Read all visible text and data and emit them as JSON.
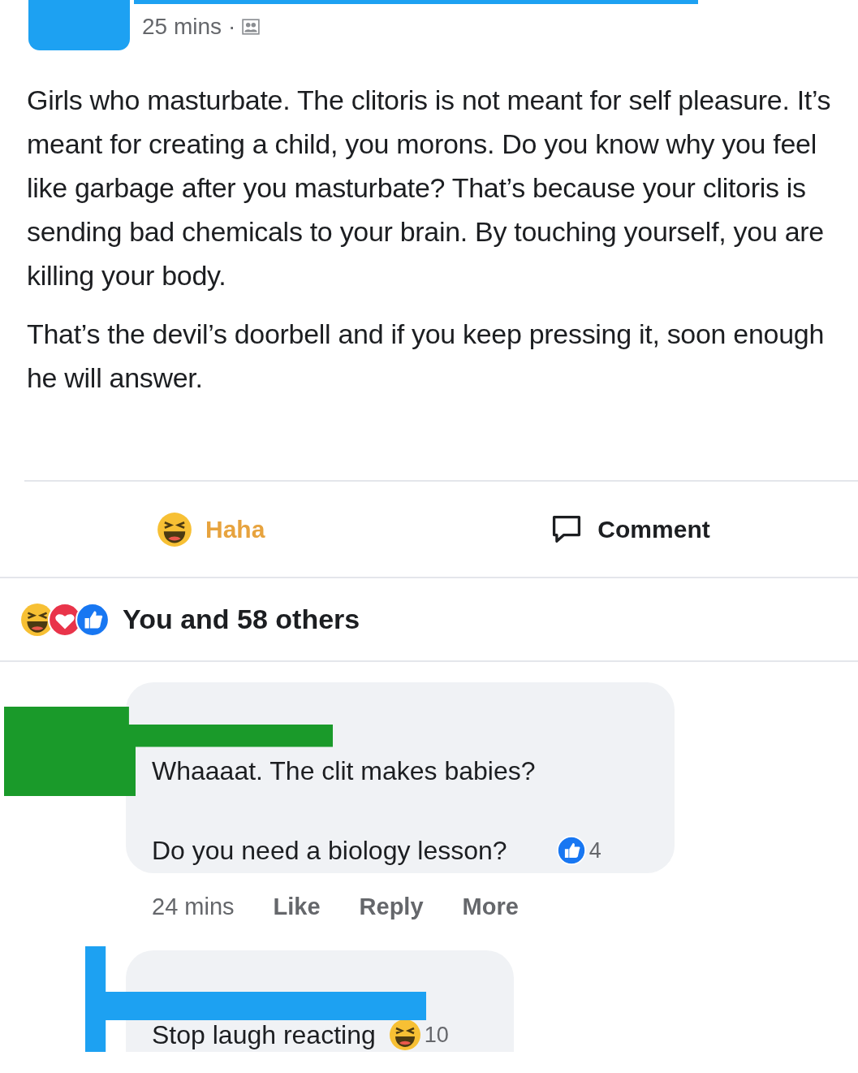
{
  "post": {
    "time": "25 mins",
    "separator": "·",
    "paragraphs": [
      "Girls who masturbate. The clitoris is not meant for self pleasure. It’s meant for creating a child, you morons. Do you know why you feel like garbage after you masturbate? That’s because your clitoris is sending bad chemicals to your brain. By touching yourself, you are killing your body.",
      "That’s the devil’s doorbell and if you keep pressing it, soon enough he will answer."
    ],
    "actions": [
      {
        "kind": "haha",
        "label": "Haha",
        "selected": true
      },
      {
        "kind": "comment",
        "label": "Comment",
        "selected": false
      }
    ]
  },
  "reactions": {
    "summary": "You and 58 others"
  },
  "comments": [
    {
      "lines": [
        "Whaaaat. The clit makes babies?",
        "Do you need a biology lesson?"
      ],
      "kind": "like",
      "count": "4",
      "time": "24 mins",
      "actions": [
        "Like",
        "Reply",
        "More"
      ]
    },
    {
      "lines": [
        "Stop laugh reacting"
      ],
      "kind": "haha",
      "count": "10"
    }
  ]
}
